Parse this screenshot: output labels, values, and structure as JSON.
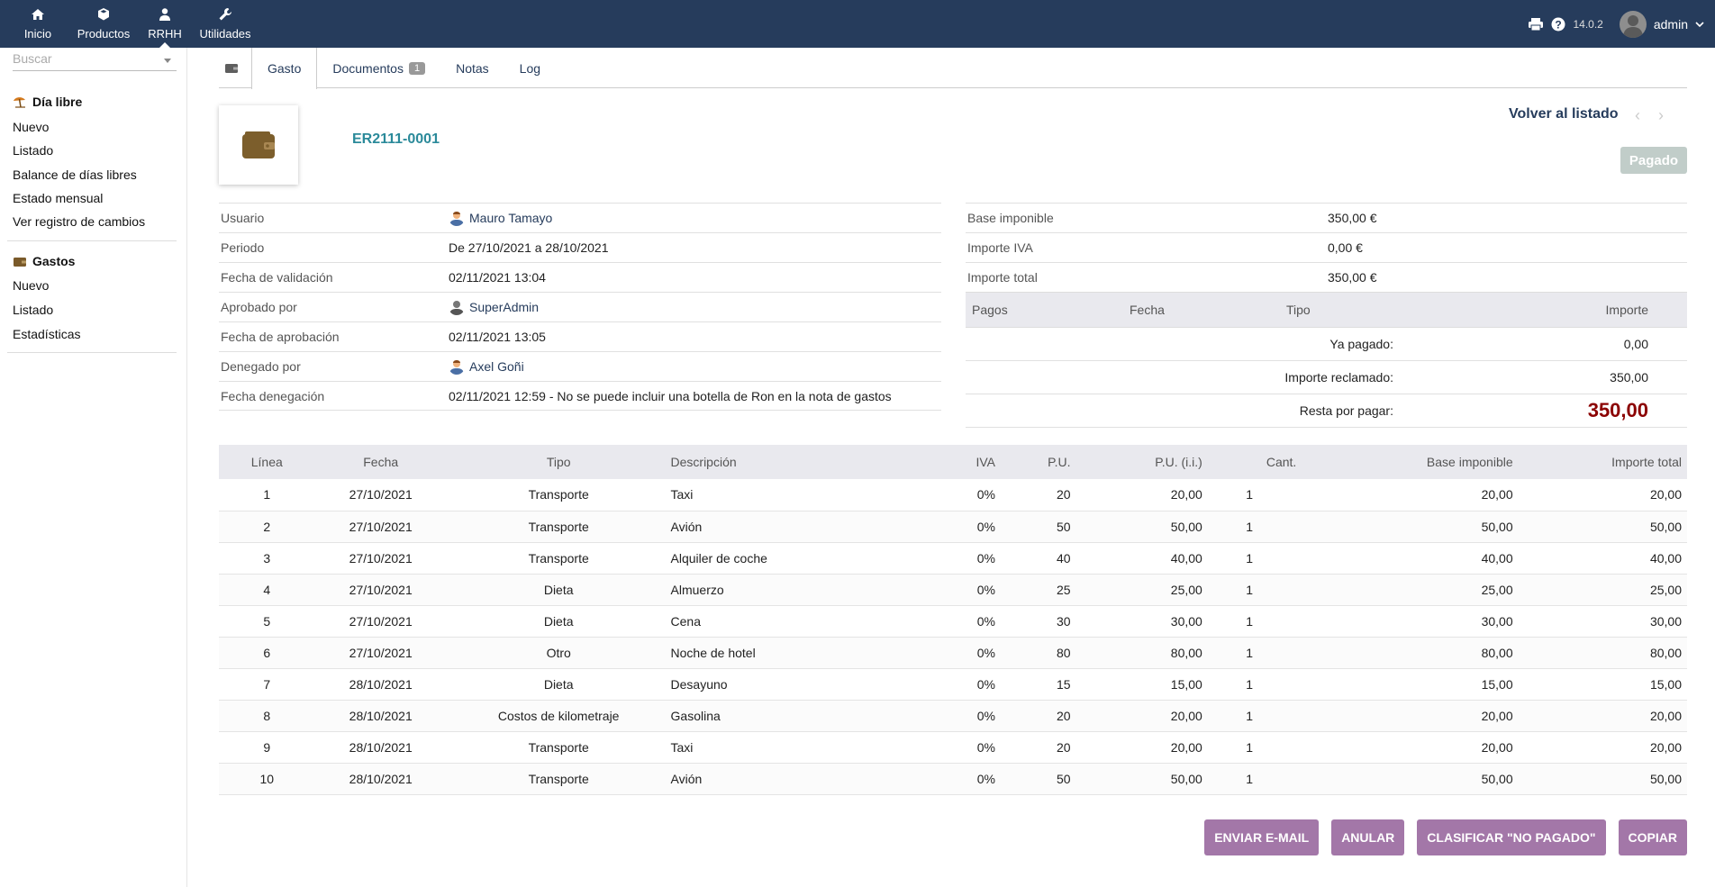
{
  "topmenu": [
    {
      "label": "Inicio",
      "icon": "home-icon"
    },
    {
      "label": "Productos",
      "icon": "box-icon"
    },
    {
      "label": "RRHH",
      "icon": "user-icon"
    },
    {
      "label": "Utilidades",
      "icon": "wrench-icon"
    }
  ],
  "topright": {
    "version": "14.0.2",
    "user": "admin"
  },
  "sidebar": {
    "search_placeholder": "Buscar",
    "section1": {
      "title": "Día libre",
      "items": [
        "Nuevo",
        "Listado",
        "Balance de días libres",
        "Estado mensual",
        "Ver registro de cambios"
      ]
    },
    "section2": {
      "title": "Gastos",
      "items": [
        "Nuevo",
        "Listado",
        "Estadísticas"
      ]
    }
  },
  "tabs": {
    "gasto": "Gasto",
    "documentos": "Documentos",
    "documentos_count": "1",
    "notas": "Notas",
    "log": "Log"
  },
  "header": {
    "ref": "ER2111-0001",
    "back": "Volver al listado",
    "status": "Pagado"
  },
  "info_left": [
    {
      "label": "Usuario",
      "value": "Mauro Tamayo"
    },
    {
      "label": "Periodo",
      "value": "De 27/10/2021 a 28/10/2021"
    },
    {
      "label": "Fecha de validación",
      "value": "02/11/2021 13:04"
    },
    {
      "label": "Aprobado por",
      "value": "SuperAdmin"
    },
    {
      "label": "Fecha de aprobación",
      "value": "02/11/2021 13:05"
    },
    {
      "label": "Denegado por",
      "value": "Axel Goñi"
    },
    {
      "label": "Fecha denegación",
      "value": "02/11/2021 12:59 - No se puede incluir una botella de Ron en la nota de gastos"
    }
  ],
  "info_right": [
    {
      "label": "Base imponible",
      "value": "350,00 €"
    },
    {
      "label": "Importe IVA",
      "value": "0,00 €"
    },
    {
      "label": "Importe total",
      "value": "350,00 €"
    }
  ],
  "payments": {
    "headers": {
      "pagos": "Pagos",
      "fecha": "Fecha",
      "tipo": "Tipo",
      "importe": "Importe"
    },
    "ya_pagado_label": "Ya pagado:",
    "ya_pagado": "0,00",
    "reclamado_label": "Importe reclamado:",
    "reclamado": "350,00",
    "resta_label": "Resta por pagar:",
    "resta": "350,00"
  },
  "lines": {
    "headers": [
      "Línea",
      "Fecha",
      "Tipo",
      "Descripción",
      "IVA",
      "P.U.",
      "P.U. (i.i.)",
      "Cant.",
      "Base imponible",
      "Importe total"
    ],
    "rows": [
      [
        "1",
        "27/10/2021",
        "Transporte",
        "Taxi",
        "0%",
        "20",
        "20,00",
        "1",
        "20,00",
        "20,00"
      ],
      [
        "2",
        "27/10/2021",
        "Transporte",
        "Avión",
        "0%",
        "50",
        "50,00",
        "1",
        "50,00",
        "50,00"
      ],
      [
        "3",
        "27/10/2021",
        "Transporte",
        "Alquiler de coche",
        "0%",
        "40",
        "40,00",
        "1",
        "40,00",
        "40,00"
      ],
      [
        "4",
        "27/10/2021",
        "Dieta",
        "Almuerzo",
        "0%",
        "25",
        "25,00",
        "1",
        "25,00",
        "25,00"
      ],
      [
        "5",
        "27/10/2021",
        "Dieta",
        "Cena",
        "0%",
        "30",
        "30,00",
        "1",
        "30,00",
        "30,00"
      ],
      [
        "6",
        "27/10/2021",
        "Otro",
        "Noche de hotel",
        "0%",
        "80",
        "80,00",
        "1",
        "80,00",
        "80,00"
      ],
      [
        "7",
        "28/10/2021",
        "Dieta",
        "Desayuno",
        "0%",
        "15",
        "15,00",
        "1",
        "15,00",
        "15,00"
      ],
      [
        "8",
        "28/10/2021",
        "Costos de kilometraje",
        "Gasolina",
        "0%",
        "20",
        "20,00",
        "1",
        "20,00",
        "20,00"
      ],
      [
        "9",
        "28/10/2021",
        "Transporte",
        "Taxi",
        "0%",
        "20",
        "20,00",
        "1",
        "20,00",
        "20,00"
      ],
      [
        "10",
        "28/10/2021",
        "Transporte",
        "Avión",
        "0%",
        "50",
        "50,00",
        "1",
        "50,00",
        "50,00"
      ]
    ]
  },
  "actions": {
    "email": "ENVIAR E-MAIL",
    "anular": "ANULAR",
    "no_pagado": "CLASIFICAR \"NO PAGADO\"",
    "copiar": "COPIAR"
  }
}
